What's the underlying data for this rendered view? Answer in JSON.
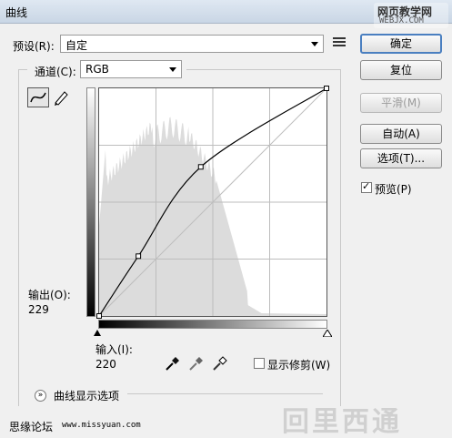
{
  "window": {
    "title": "曲线",
    "watermark_top": {
      "line1": "网页教学网",
      "line2": "WEBJX.COM"
    },
    "watermark_bottom": {
      "text1": "思缘论坛",
      "text2": "www.missyuan.com",
      "logo": "回里西通"
    }
  },
  "preset": {
    "label": "预设(R):",
    "value": "自定"
  },
  "channel": {
    "label": "通道(C):",
    "value": "RGB"
  },
  "output": {
    "label": "输出(O):",
    "value": "229"
  },
  "input": {
    "label": "输入(I):",
    "value": "220"
  },
  "clipping": {
    "label": "显示修剪(W)",
    "checked": false
  },
  "preview": {
    "label": "预览(P)",
    "checked": true
  },
  "curve_options": {
    "label": "曲线显示选项"
  },
  "buttons": {
    "ok": "确定",
    "reset": "复位",
    "smooth": "平滑(M)",
    "auto": "自动(A)",
    "options": "选项(T)..."
  },
  "icons": {
    "menu": "list-menu-icon",
    "curve_tool": "curve-tool-icon",
    "pencil_tool": "pencil-icon",
    "black_eyedropper": "eyedropper-black-icon",
    "gray_eyedropper": "eyedropper-gray-icon",
    "white_eyedropper": "eyedropper-white-icon"
  },
  "curve": {
    "points": [
      {
        "input": 0,
        "output": 0
      },
      {
        "input": 44,
        "output": 67
      },
      {
        "input": 114,
        "output": 167
      },
      {
        "input": 255,
        "output": 255
      }
    ]
  },
  "colors": {
    "histogram": "#dcdcdc",
    "grid": "#bdbdbd",
    "curve": "#000000",
    "default_button_border": "#4a7fc0"
  }
}
